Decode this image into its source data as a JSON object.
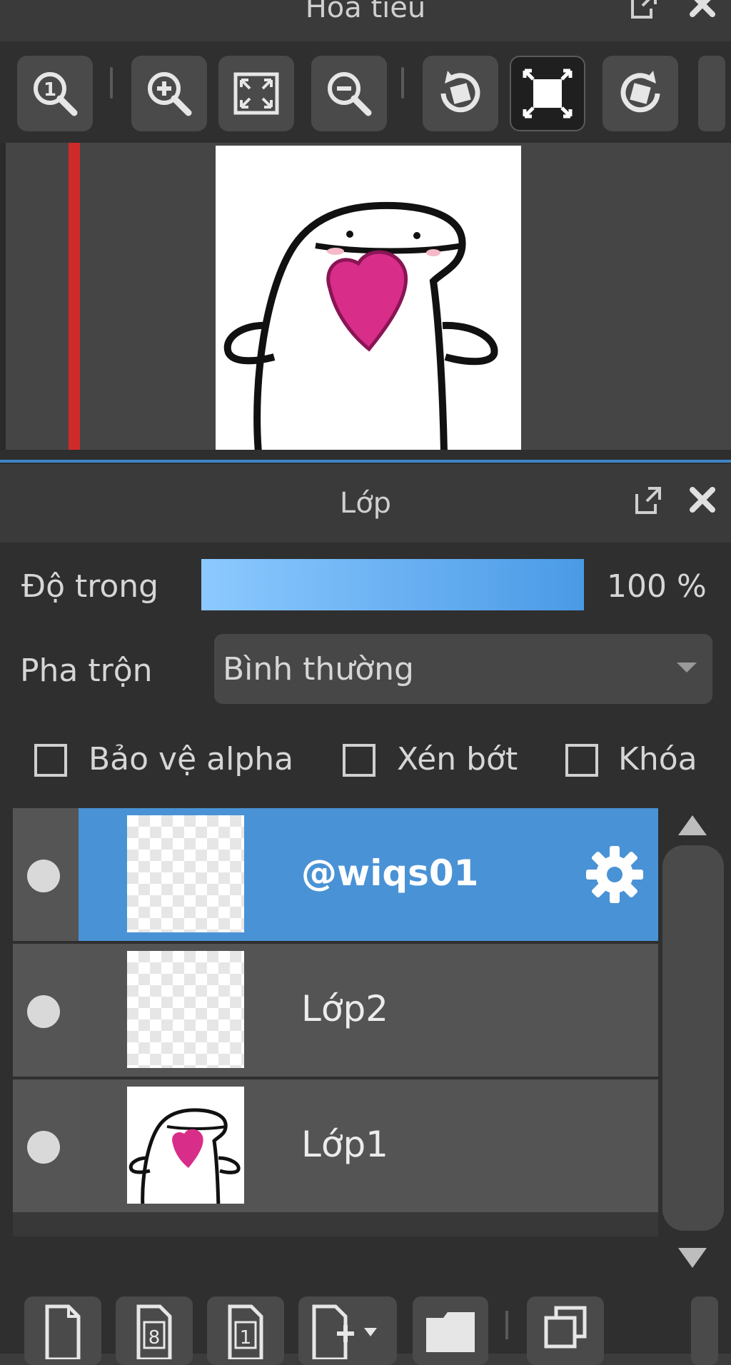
{
  "navigator": {
    "title": "Hoa tiêu",
    "toolbar": [
      "actual-size",
      "zoom-in",
      "fit",
      "zoom-out",
      "rotate-left",
      "reset-rotation",
      "rotate-right"
    ]
  },
  "layers_panel": {
    "title": "Lớp",
    "opacity": {
      "label": "Độ trong",
      "value": 1.0,
      "value_text": "100 %"
    },
    "blend": {
      "label": "Pha trộn",
      "value": "Bình thường"
    },
    "checkboxes": [
      {
        "label": "Bảo vệ alpha",
        "checked": false
      },
      {
        "label": "Xén bớt",
        "checked": false
      },
      {
        "label": "Khóa",
        "checked": false
      }
    ],
    "layers": [
      {
        "name": "@wiqs01",
        "selected": true
      },
      {
        "name": "Lớp2",
        "selected": false
      },
      {
        "name": "Lớp1",
        "selected": false
      }
    ]
  },
  "colors": {
    "accent": "#4a92d6",
    "opacity_gradient_start": "#8cc9ff",
    "opacity_gradient_end": "#4a9ae6",
    "heart": "#d92d8a",
    "red_line": "#cf2a2a"
  }
}
